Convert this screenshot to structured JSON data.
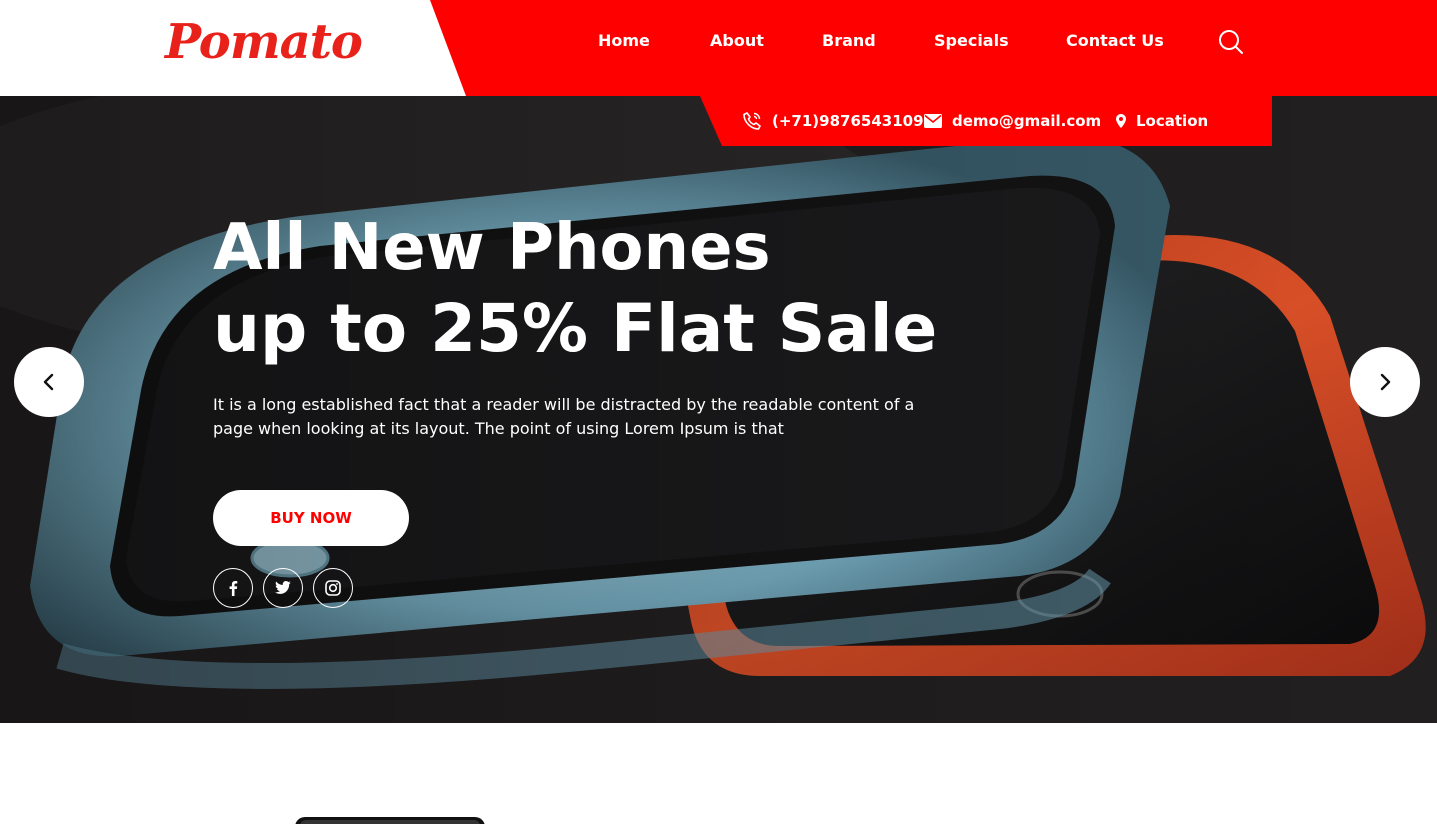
{
  "brand": {
    "logo_text": "Pomato",
    "color": "#e8211a"
  },
  "nav": {
    "items": [
      {
        "label": "Home"
      },
      {
        "label": "About"
      },
      {
        "label": "Brand"
      },
      {
        "label": "Specials"
      },
      {
        "label": "Contact Us"
      }
    ],
    "search_icon": "search-icon"
  },
  "contact": {
    "phone": "(+71)9876543109",
    "email": "demo@gmail.com",
    "location": "Location"
  },
  "hero": {
    "title_line1": "All New Phones",
    "title_line2": "up to 25% Flat Sale",
    "description": "It is a long established fact that a reader will be distracted by the readable content of a page when looking at its layout. The point of using Lorem Ipsum is that",
    "button_label": "BUY NOW",
    "social_icons": [
      "facebook-icon",
      "twitter-icon",
      "instagram-icon"
    ],
    "prev_icon": "chevron-left-icon",
    "next_icon": "chevron-right-icon"
  },
  "theme": {
    "accent": "#ff0000",
    "text_light": "#ffffff"
  }
}
